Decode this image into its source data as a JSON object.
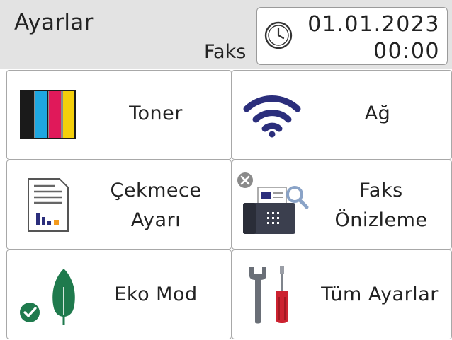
{
  "header": {
    "title": "Ayarlar",
    "mode": "Faks",
    "date": "01.01.2023",
    "time": "00:00",
    "clock_icon": "clock-icon"
  },
  "tiles": [
    {
      "label_line1": "Toner",
      "icon": "toner-cartridges-icon"
    },
    {
      "label_line1": "Ağ",
      "icon": "wifi-icon"
    },
    {
      "label_line1": "Çekmece",
      "label_line2": "Ayarı",
      "icon": "tray-settings-icon"
    },
    {
      "label_line1": "Faks",
      "label_line2": "Önizleme",
      "icon": "fax-preview-icon"
    },
    {
      "label_line1": "Eko Mod",
      "icon": "eco-leaf-icon"
    },
    {
      "label_line1": "Tüm Ayarlar",
      "icon": "tools-icon"
    }
  ],
  "colors": {
    "header_bg": "#e3e3e3",
    "toner": [
      "#1a1a1a",
      "#1ea7e1",
      "#e0195a",
      "#f4cf0b"
    ],
    "wifi": "#2b2e7c",
    "eco_green": "#1f7a4d",
    "screwdriver_red": "#cc2230"
  }
}
